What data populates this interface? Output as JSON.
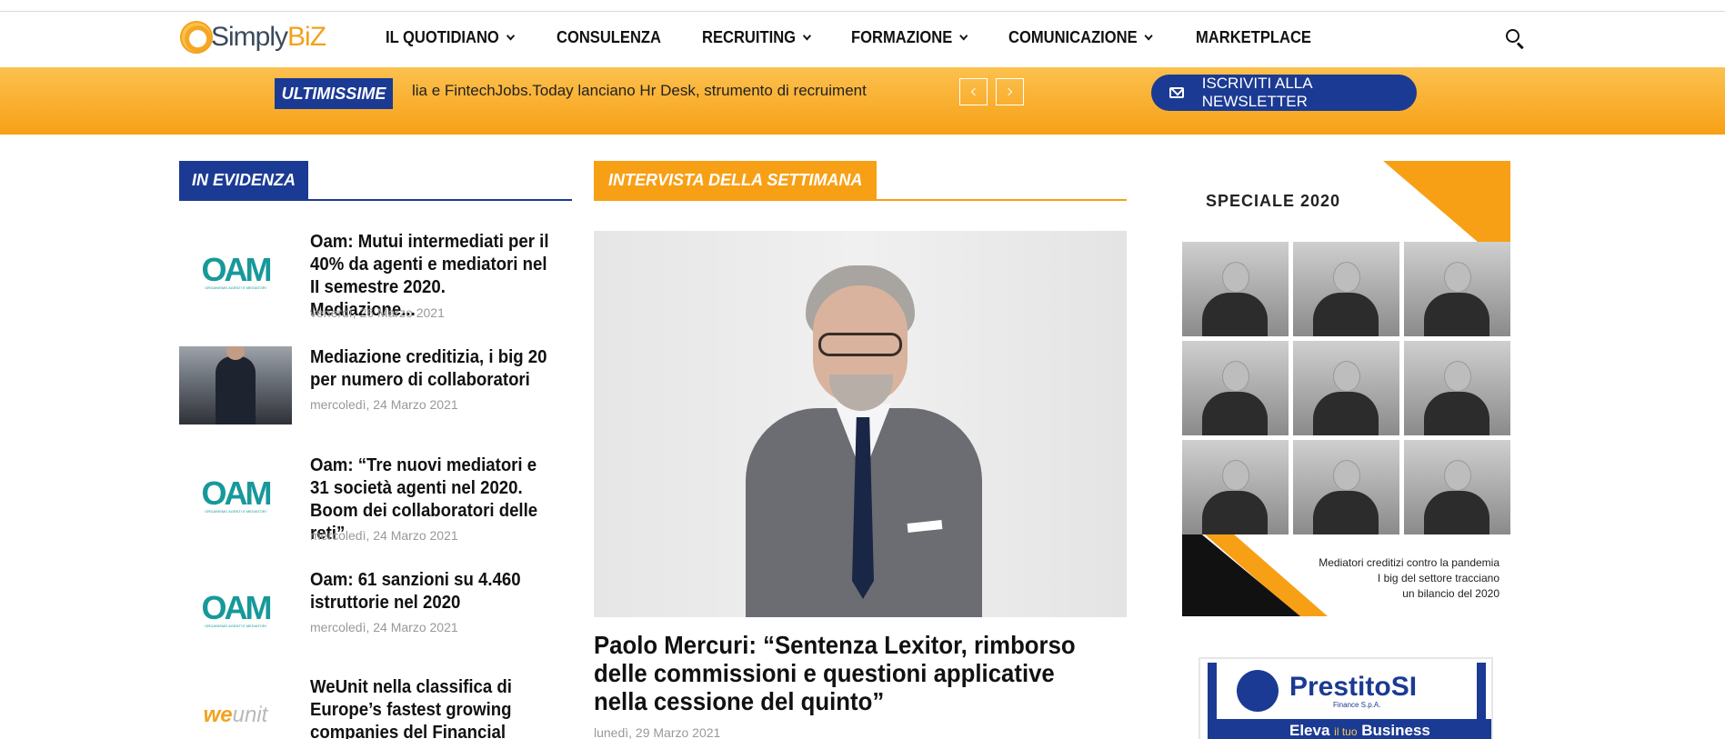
{
  "header": {
    "logo_simply": "Simply",
    "logo_biz": "BiZ",
    "nav": [
      {
        "label": "IL QUOTIDIANO",
        "has_dropdown": true
      },
      {
        "label": "CONSULENZA",
        "has_dropdown": false
      },
      {
        "label": "RECRUITING",
        "has_dropdown": true
      },
      {
        "label": "FORMAZIONE",
        "has_dropdown": true
      },
      {
        "label": "COMUNICAZIONE",
        "has_dropdown": true
      },
      {
        "label": "MARKETPLACE",
        "has_dropdown": false
      }
    ]
  },
  "band": {
    "ultimissime_label": "ULTIMISSIME",
    "ticker_text": "lia e FintechJobs.Today lanciano Hr Desk, strumento di recruiment",
    "newsletter_label": "ISCRIVITI ALLA NEWSLETTER"
  },
  "evidenza": {
    "label": "IN EVIDENZA",
    "items": [
      {
        "title": "Oam: Mutui intermediati per il 40% da agenti e mediatori nel II semestre 2020. Mediazione...",
        "date": "venerdì, 26 Marzo 2021",
        "thumb": "OAM"
      },
      {
        "title": "Mediazione creditizia, i big 20 per numero di collaboratori",
        "date": "mercoledì, 24 Marzo 2021",
        "thumb": "photo"
      },
      {
        "title": "Oam: “Tre nuovi mediatori e 31 società agenti nel 2020. Boom dei collaboratori delle reti”",
        "date": "mercoledì, 24 Marzo 2021",
        "thumb": "OAM"
      },
      {
        "title": "Oam: 61 sanzioni su 4.460 istruttorie nel 2020",
        "date": "mercoledì, 24 Marzo 2021",
        "thumb": "OAM"
      },
      {
        "title": "WeUnit nella classifica di Europe’s fastest growing companies del Financial Times",
        "date": "",
        "thumb": "wenit"
      }
    ]
  },
  "intervista": {
    "label": "INTERVISTA DELLA SETTIMANA",
    "title": "Paolo Mercuri: “Sentenza Lexitor, rimborso delle commissioni e questioni applicative nella cessione del quinto”",
    "date": "lunedì, 29 Marzo 2021"
  },
  "sidebar": {
    "speciale_title": "SPECIALE 2020",
    "speciale_caption_1": "Mediatori creditizi contro la pandemia",
    "speciale_caption_2": "I big del settore tracciano",
    "speciale_caption_3": "un bilancio del 2020",
    "ad_name": "PrestitoSI",
    "ad_sub": "Finance S.p.A.",
    "ad_slogan": "Eleva",
    "ad_slogan_small": "il tuo",
    "ad_slogan_end": "Business"
  },
  "colors": {
    "brand_blue": "#1b3a93",
    "brand_orange": "#f7a016"
  }
}
